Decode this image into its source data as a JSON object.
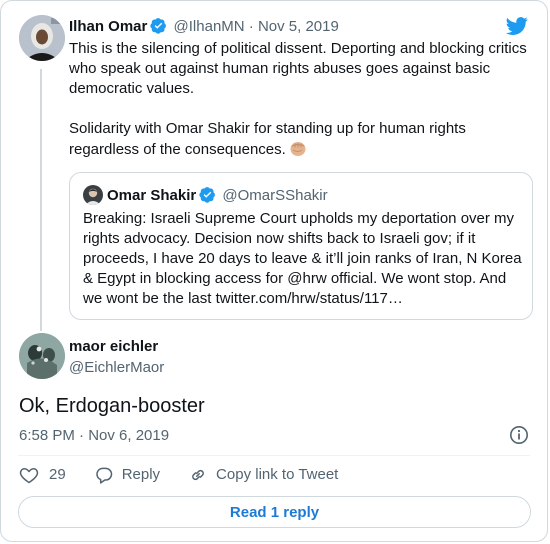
{
  "parent_tweet": {
    "author_name": "Ilhan Omar",
    "handle_date": "@IlhanMN · Nov 5, 2019",
    "paragraph_1": "This is the silencing of political dissent. Deporting and blocking critics who speak out against human rights abuses goes against basic democratic values.",
    "paragraph_2": "Solidarity with Omar Shakir for standing up for human rights regardless of the consequences.",
    "emoji": "raised-fist-emoji"
  },
  "quoted_tweet": {
    "author_name": "Omar Shakir",
    "handle": "@OmarSShakir",
    "text": "Breaking: Israeli Supreme Court upholds my deportation over my rights advocacy. Decision now shifts back to Israeli gov; if it proceeds, I have 20 days to leave & it’ll join ranks of Iran, N Korea & Egypt in blocking access for @hrw official. We wont stop. And we wont be the last twitter.com/hrw/status/117…"
  },
  "reply_tweet": {
    "author_name": "maor eichler",
    "handle": "@EichlerMaor",
    "text": "Ok, Erdogan-booster",
    "timestamp": "6:58 PM · Nov 6, 2019"
  },
  "actions": {
    "like_count": "29",
    "reply_label": "Reply",
    "copy_link_label": "Copy link to Tweet"
  },
  "read_replies_label": "Read 1 reply",
  "colors": {
    "twitter_blue": "#1d9bf0",
    "link_blue": "#1d7bd6",
    "muted_text": "#536471",
    "border": "#cfd9de"
  }
}
